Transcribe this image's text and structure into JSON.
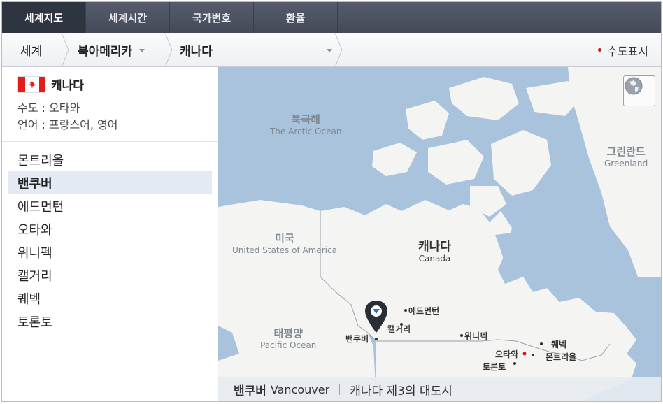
{
  "tabs": [
    {
      "label": "세계지도",
      "active": true
    },
    {
      "label": "세계시간",
      "active": false
    },
    {
      "label": "국가번호",
      "active": false
    },
    {
      "label": "환율",
      "active": false
    }
  ],
  "breadcrumb": {
    "world": "세계",
    "region": "북아메리카",
    "country": "캐나다"
  },
  "capital_toggle": "수도표시",
  "country_info": {
    "name": "캐나다",
    "capital": "수도 : 오타와",
    "language": "언어 : 프랑스어, 영어"
  },
  "cities": [
    "몬트리올",
    "밴쿠버",
    "에드먼턴",
    "오타와",
    "위니펙",
    "캘거리",
    "퀘벡",
    "토론토"
  ],
  "selected_city_index": 1,
  "map": {
    "arctic_ko": "북극해",
    "arctic_en": "The Arctic Ocean",
    "greenland_ko": "그린란드",
    "greenland_en": "Greenland",
    "usa_ko": "미국",
    "usa_en": "United States of America",
    "canada_ko": "캐나다",
    "canada_en": "Canada",
    "pacific_ko": "태평양",
    "pacific_en": "Pacific Ocean",
    "city_labels": {
      "edmonton": "에드먼턴",
      "calgary": "캘거리",
      "vancouver": "밴쿠버",
      "winnipeg": "위니펙",
      "ottawa": "오타와",
      "quebec": "퀘벡",
      "montreal": "몬트리올",
      "toronto": "토론토"
    }
  },
  "caption": {
    "city_ko": "밴쿠버",
    "city_en": "Vancouver",
    "description": "캐나다 제3의 대도시"
  },
  "colors": {
    "ocean": "#a9c3dc",
    "land": "#f4f5f2",
    "tab_active": "#2f3441",
    "capital_dot": "#dd1111"
  }
}
